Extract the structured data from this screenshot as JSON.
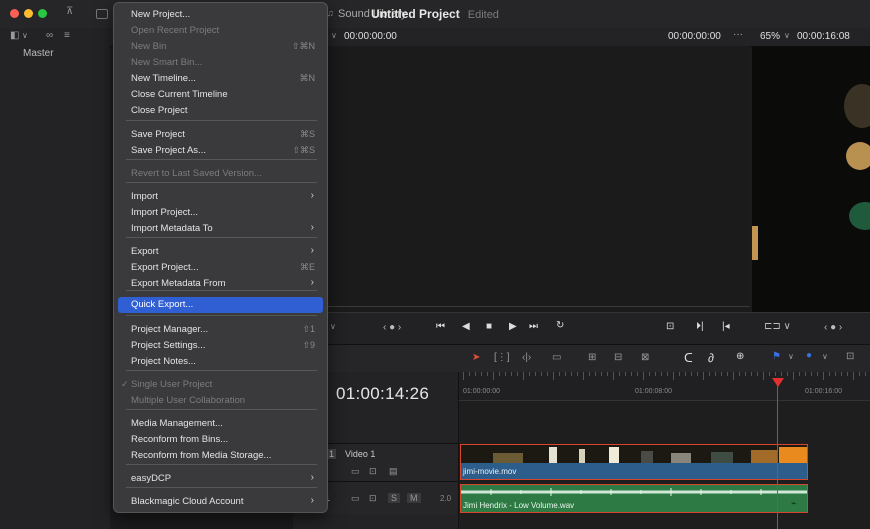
{
  "window": {
    "title": "Untitled Project",
    "status": "Edited",
    "sound_library": "Sound Library"
  },
  "viewer": {
    "source_timecode": "00:00:00:00",
    "program_timecode": "00:00:00:00",
    "zoom": "65%",
    "duration_timecode": "00:00:16:08"
  },
  "media_pool": {
    "master_label": "Master"
  },
  "timeline": {
    "timecode": "01:00:14:26",
    "ruler": [
      "01:00:00:00",
      "01:00:08:00",
      "01:00:16:00"
    ],
    "video_track": {
      "index": "1",
      "name": "Video 1"
    },
    "audio_track": {
      "index": "1",
      "s": "S",
      "m": "M",
      "level": "2.0"
    },
    "video_clip": "jimi-movie.mov",
    "audio_clip": "Jimi Hendrix - Low Volume.wav"
  },
  "menu": {
    "items": [
      {
        "label": "New Project...",
        "shortcut": "",
        "disabled": false
      },
      {
        "label": "Open Recent Project",
        "shortcut": "",
        "disabled": true
      },
      {
        "label": "New Bin",
        "shortcut": "⇧⌘N",
        "disabled": true
      },
      {
        "label": "New Smart Bin...",
        "shortcut": "",
        "disabled": true
      },
      {
        "label": "New Timeline...",
        "shortcut": "⌘N",
        "disabled": false
      },
      {
        "label": "Close Current Timeline",
        "shortcut": "",
        "disabled": false
      },
      {
        "label": "Close Project",
        "shortcut": "",
        "disabled": false
      },
      {
        "label": "Save Project",
        "shortcut": "⌘S",
        "disabled": false
      },
      {
        "label": "Save Project As...",
        "shortcut": "⇧⌘S",
        "disabled": false
      },
      {
        "label": "Revert to Last Saved Version...",
        "shortcut": "",
        "disabled": true
      },
      {
        "label": "Import",
        "shortcut": "",
        "disabled": false,
        "submenu": true
      },
      {
        "label": "Import Project...",
        "shortcut": "",
        "disabled": false
      },
      {
        "label": "Import Metadata To",
        "shortcut": "",
        "disabled": false,
        "submenu": true
      },
      {
        "label": "Export",
        "shortcut": "",
        "disabled": false,
        "submenu": true
      },
      {
        "label": "Export Project...",
        "shortcut": "⌘E",
        "disabled": false
      },
      {
        "label": "Export Metadata From",
        "shortcut": "",
        "disabled": false,
        "submenu": true
      },
      {
        "label": "Quick Export...",
        "shortcut": "",
        "disabled": false,
        "selected": true
      },
      {
        "label": "Project Manager...",
        "shortcut": "⇧1",
        "disabled": false
      },
      {
        "label": "Project Settings...",
        "shortcut": "⇧9",
        "disabled": false
      },
      {
        "label": "Project Notes...",
        "shortcut": "",
        "disabled": false
      },
      {
        "label": "Single User Project",
        "shortcut": "",
        "disabled": true,
        "checked": true
      },
      {
        "label": "Multiple User Collaboration",
        "shortcut": "",
        "disabled": true
      },
      {
        "label": "Media Management...",
        "shortcut": "",
        "disabled": false
      },
      {
        "label": "Reconform from Bins...",
        "shortcut": "",
        "disabled": false
      },
      {
        "label": "Reconform from Media Storage...",
        "shortcut": "",
        "disabled": false
      },
      {
        "label": "easyDCP",
        "shortcut": "",
        "disabled": false,
        "submenu": true
      },
      {
        "label": "Blackmagic Cloud Account",
        "shortcut": "",
        "disabled": false,
        "submenu": true
      }
    ]
  },
  "colors": {
    "accent": "#2f5fd2",
    "playhead": "#e03030",
    "video_clip": "#2d5e8b",
    "audio_clip": "#2e7a45"
  }
}
